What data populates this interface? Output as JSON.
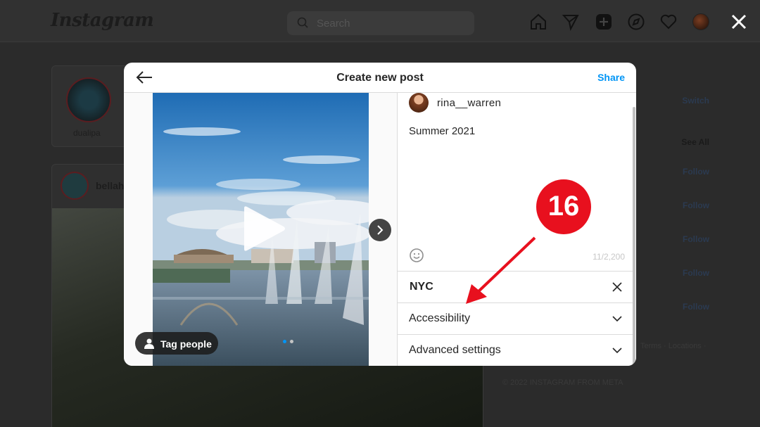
{
  "background": {
    "logo": "Instagram",
    "search_placeholder": "Search",
    "story_name": "dualipa",
    "post_user": "bellah",
    "side": {
      "switch": "Switch",
      "see_all": "See All",
      "follow": [
        "Follow",
        "Follow",
        "Follow",
        "Follow",
        "Follow"
      ],
      "footer_links": "Terms · Locations ·",
      "copyright": "© 2022 INSTAGRAM FROM META"
    }
  },
  "modal": {
    "title": "Create new post",
    "share_label": "Share",
    "tag_people_label": "Tag people",
    "username": "rina__warren",
    "caption": "Summer 2021",
    "char_count": "11/2,200",
    "location": "NYC",
    "accessibility_label": "Accessibility",
    "advanced_label": "Advanced settings",
    "carousel": {
      "total": 2,
      "current": 1
    }
  },
  "annotation": {
    "step": "16",
    "color": "#e8101e"
  },
  "colors": {
    "accent": "#0095f6",
    "overlay": "#2b2b2b"
  }
}
